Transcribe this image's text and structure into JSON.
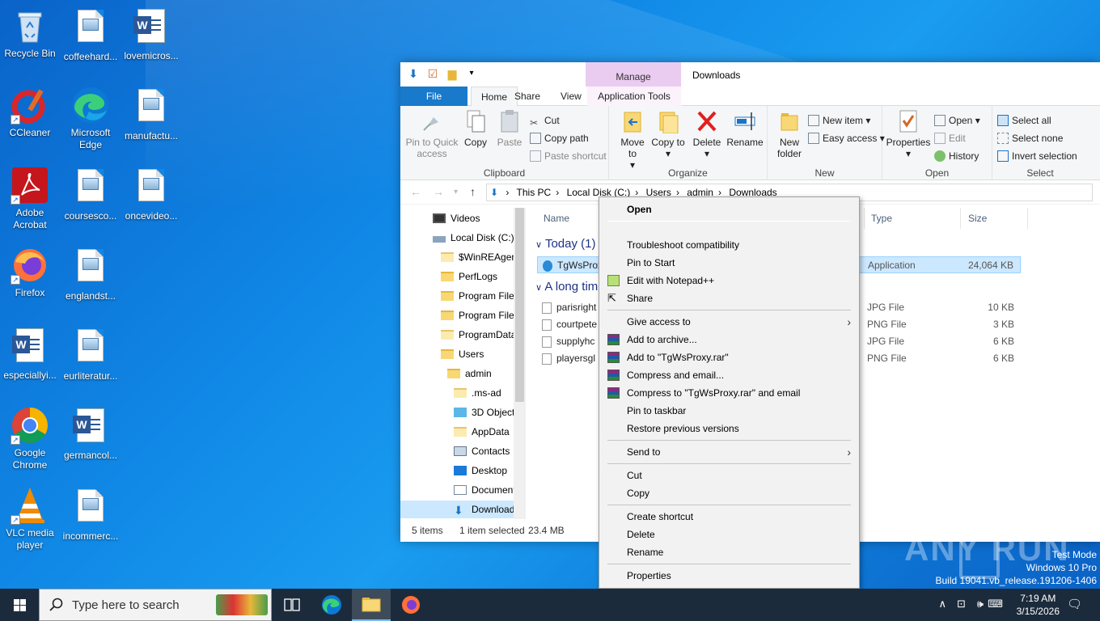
{
  "desktop": {
    "icons": [
      {
        "label": "Recycle Bin",
        "icon": "recycle-bin-icon"
      },
      {
        "label": "coffeehard...",
        "icon": "image-file-icon"
      },
      {
        "label": "lovemicros...",
        "icon": "word-doc-icon"
      },
      {
        "label": "CCleaner",
        "icon": "ccleaner-icon"
      },
      {
        "label": "Microsoft Edge",
        "icon": "edge-icon"
      },
      {
        "label": "manufactu...",
        "icon": "image-file-icon"
      },
      {
        "label": "Adobe Acrobat",
        "icon": "acrobat-icon"
      },
      {
        "label": "coursesco...",
        "icon": "image-file-icon"
      },
      {
        "label": "oncevideo...",
        "icon": "image-file-icon"
      },
      {
        "label": "Firefox",
        "icon": "firefox-icon"
      },
      {
        "label": "englandst...",
        "icon": "image-file-icon"
      },
      {
        "label": "especiallyi...",
        "icon": "word-doc-icon"
      },
      {
        "label": "eurliteratur...",
        "icon": "image-file-icon"
      },
      {
        "label": "Google Chrome",
        "icon": "chrome-icon"
      },
      {
        "label": "germancol...",
        "icon": "word-doc-icon"
      },
      {
        "label": "VLC media player",
        "icon": "vlc-icon"
      },
      {
        "label": "incommerc...",
        "icon": "image-file-icon"
      }
    ]
  },
  "explorer": {
    "title": "Downloads",
    "context_tab": "Manage",
    "tabs": {
      "file": "File",
      "home": "Home",
      "share": "Share",
      "view": "View",
      "apptools": "Application Tools"
    },
    "ribbon": {
      "clipboard": {
        "label": "Clipboard",
        "pin": "Pin to Quick access",
        "copy": "Copy",
        "paste": "Paste",
        "cut": "Cut",
        "copy_path": "Copy path",
        "paste_shortcut": "Paste shortcut"
      },
      "organize": {
        "label": "Organize",
        "move_to": "Move to",
        "copy_to": "Copy to",
        "delete": "Delete",
        "rename": "Rename"
      },
      "new": {
        "label": "New",
        "new_folder": "New folder",
        "new_item": "New item",
        "easy_access": "Easy access"
      },
      "open": {
        "label": "Open",
        "properties": "Properties",
        "open": "Open",
        "edit": "Edit",
        "history": "History"
      },
      "select": {
        "label": "Select",
        "select_all": "Select all",
        "select_none": "Select none",
        "invert": "Invert selection"
      }
    },
    "breadcrumb": [
      "This PC",
      "Local Disk (C:)",
      "Users",
      "admin",
      "Downloads"
    ],
    "nav": [
      {
        "label": "Videos",
        "indent": 1
      },
      {
        "label": "Local Disk (C:)",
        "indent": 0
      },
      {
        "label": "$WinREAgent",
        "indent": 1
      },
      {
        "label": "PerfLogs",
        "indent": 1
      },
      {
        "label": "Program Files",
        "indent": 1
      },
      {
        "label": "Program Files",
        "indent": 1
      },
      {
        "label": "ProgramData",
        "indent": 1
      },
      {
        "label": "Users",
        "indent": 1
      },
      {
        "label": "admin",
        "indent": 2
      },
      {
        "label": ".ms-ad",
        "indent": 3
      },
      {
        "label": "3D Objects",
        "indent": 3
      },
      {
        "label": "AppData",
        "indent": 3
      },
      {
        "label": "Contacts",
        "indent": 3
      },
      {
        "label": "Desktop",
        "indent": 3
      },
      {
        "label": "Document",
        "indent": 3
      },
      {
        "label": "Download",
        "indent": 3
      }
    ],
    "columns": {
      "name": "Name",
      "type": "Type",
      "size": "Size"
    },
    "groups": {
      "today": "Today (1)",
      "long_ago": "A long tim"
    },
    "files_today": [
      {
        "name": "TgWsProx",
        "type": "Application",
        "size": "24,064 KB"
      }
    ],
    "files_old": [
      {
        "name": "parisright",
        "type": "JPG File",
        "size": "10 KB"
      },
      {
        "name": "courtpete",
        "type": "PNG File",
        "size": "3 KB"
      },
      {
        "name": "supplyhc",
        "type": "JPG File",
        "size": "6 KB"
      },
      {
        "name": "playersgl",
        "type": "PNG File",
        "size": "6 KB"
      }
    ],
    "status": {
      "items": "5 items",
      "selected": "1 item selected",
      "size": "23.4 MB"
    }
  },
  "context_menu": {
    "items": [
      {
        "label": "Open",
        "bold": true
      },
      {
        "label": "Troubleshoot compatibility"
      },
      {
        "label": "Pin to Start"
      },
      {
        "label": "Edit with Notepad++",
        "icon": "notepad-plus-icon"
      },
      {
        "label": "Share",
        "icon": "share-icon"
      },
      {
        "label": "Give access to",
        "submenu": true
      },
      {
        "label": "Add to archive...",
        "icon": "winrar-icon"
      },
      {
        "label": "Add to \"TgWsProxy.rar\"",
        "icon": "winrar-icon"
      },
      {
        "label": "Compress and email...",
        "icon": "winrar-icon"
      },
      {
        "label": "Compress to \"TgWsProxy.rar\" and email",
        "icon": "winrar-icon"
      },
      {
        "label": "Pin to taskbar"
      },
      {
        "label": "Restore previous versions"
      },
      {
        "label": "Send to",
        "submenu": true
      },
      {
        "label": "Cut"
      },
      {
        "label": "Copy"
      },
      {
        "label": "Create shortcut"
      },
      {
        "label": "Delete"
      },
      {
        "label": "Rename"
      },
      {
        "label": "Properties"
      }
    ]
  },
  "watermark": {
    "text": "ANY RUN"
  },
  "windows_info": {
    "line1": "Test Mode",
    "line2": "Windows 10 Pro",
    "line3": "Build 19041.vb_release.191206-1406"
  },
  "taskbar": {
    "search_placeholder": "Type here to search",
    "time": "7:19 AM",
    "date": "3/15/2026"
  }
}
